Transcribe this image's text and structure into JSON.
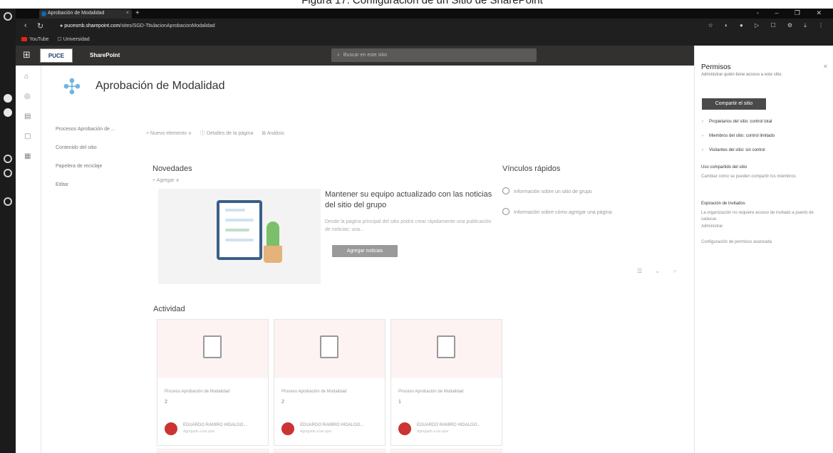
{
  "caption": "Figura 17. Configuración de un Sitio de SharePoint",
  "browser": {
    "tab_title": "Aprobación de Modalidad",
    "tab_close": "×",
    "new_tab": "+",
    "window_controls": "◦ – ❐ ✕",
    "url_host": "pucesmb.sharepoint.com",
    "url_path": "/sites/SGD-TitulacionAprobacionModalidad",
    "url_prefix": "● ",
    "bookmarks": [
      "YouTube",
      "Universidad"
    ]
  },
  "suite": {
    "logo_text": "PUCE",
    "app_name": "SharePoint",
    "search_placeholder": "Buscar en este sitio"
  },
  "site": {
    "title": "Aprobación de Modalidad",
    "nav": [
      "Procesos Aprobación de ...",
      "Contenido del sitio",
      "Papelera de reciclaje",
      "Editar"
    ],
    "command_bar": [
      "+ Nuevo elemento ∨",
      "ⓘ Detalles de la página",
      "⊞ Análisis"
    ]
  },
  "news": {
    "heading": "Novedades",
    "add_link": "+ Agregar ∨",
    "title": "Mantener su equipo actualizado con las noticias del sitio del grupo",
    "description": "Desde la página principal del sitio podrá crear rápidamente una publicación de noticias: una...",
    "button": "Agregar noticias"
  },
  "quick_links": {
    "heading": "Vínculos rápidos",
    "items": [
      "Información sobre un sitio de grupo",
      "Información sobre cómo agregar una página"
    ]
  },
  "activity": {
    "heading": "Actividad",
    "cards": [
      {
        "title": "Proceso Aprobación de Modalidad",
        "count": "2",
        "author": "EDUARDO RAMIRO HIDALGO...",
        "when": "Agregado a las ayer"
      },
      {
        "title": "Proceso Aprobación de Modalidad",
        "count": "2",
        "author": "EDUARDO RAMIRO HIDALGO...",
        "when": "Agregado a las ayer"
      },
      {
        "title": "Proceso Aprobación de Modalidad",
        "count": "1",
        "author": "EDUARDO RAMIRO HIDALGO...",
        "when": "Agregado a las ayer"
      }
    ]
  },
  "panel": {
    "title": "Permisos",
    "close": "×",
    "subtitle": "Administrar quién tiene acceso a este sitio.",
    "share_button": "Compartir el sitio",
    "groups": [
      "Propietarios del sitio: control total",
      "Miembros del sitio: control limitado",
      "Visitantes del sitio: sin control"
    ],
    "site_sharing_heading": "Uso compartido del sitio",
    "site_sharing_text": "Cambiar cómo se pueden compartir los miembros",
    "guest_heading": "Expiración de invitados",
    "guest_text": "La organización no requiere acceso de invitado a puerto de caducar.",
    "guest_link": "Administrar",
    "advanced_link": "Configuración de permisos avanzada"
  }
}
